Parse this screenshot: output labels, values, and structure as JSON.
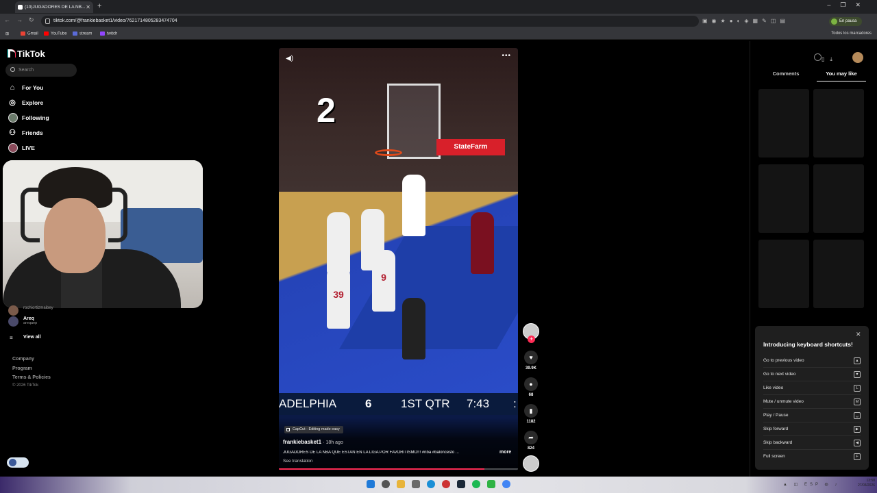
{
  "browser": {
    "tab_title": "(10)JUGADORES DE LA NB...",
    "url": "tiktok.com/@frankiebasket1/video/7621714805283474704",
    "profile_label": "En pausa",
    "bookmarks": [
      {
        "label": "Gmail",
        "color": "#ea4335"
      },
      {
        "label": "YouTube",
        "color": "#ff0000"
      },
      {
        "label": "stream",
        "color": "#5b6bd8"
      },
      {
        "label": "twitch",
        "color": "#9146ff"
      }
    ],
    "all_bookmarks": "Todos los marcadores"
  },
  "sidebar": {
    "brand": "TikTok",
    "search_placeholder": "Search",
    "nav": [
      {
        "label": "For You",
        "icon": "home-icon"
      },
      {
        "label": "Explore",
        "icon": "compass-icon"
      },
      {
        "label": "Following",
        "icon": "avatar-icon"
      },
      {
        "label": "Friends",
        "icon": "friends-icon"
      },
      {
        "label": "LIVE",
        "icon": "live-avatar-icon"
      }
    ],
    "following": [
      {
        "name": "rochiortizmaibey",
        "handle": ""
      },
      {
        "name": "Areq",
        "handle": "areqaep"
      }
    ],
    "view_all": "View all",
    "footer": [
      "Company",
      "Program",
      "Terms & Policies"
    ],
    "copyright": "© 2026 TikTok"
  },
  "video": {
    "overlay_number": "2",
    "sponsor": "StateFarm",
    "scoreboard": {
      "team": "ADELPHIA",
      "score": "6",
      "quarter": "1ST QTR",
      "clock": "7:43"
    },
    "jerseys": [
      "39",
      "9"
    ],
    "capcut": "CapCut - Editing made easy",
    "author": "frankiebasket1",
    "posted": "· 18h ago",
    "caption": "JUGADORES DE LA NBA QUE ESTAN EN LA LIGA POR FAVORITISMO!!! #nba #baloncesto ...",
    "more": "more",
    "see_translation": "See translation",
    "progress": 0.86
  },
  "actions": {
    "likes": "39.9K",
    "comments": "68",
    "saves": "1182",
    "shares": "824"
  },
  "right_panel": {
    "tab_comments": "Comments",
    "tab_you_may_like": "You may like"
  },
  "shortcuts": {
    "title": "Introducing keyboard shortcuts!",
    "items": [
      {
        "label": "Go to previous video",
        "key": "▲"
      },
      {
        "label": "Go to next video",
        "key": "▼"
      },
      {
        "label": "Like video",
        "key": "L"
      },
      {
        "label": "Mute / unmute video",
        "key": "M"
      },
      {
        "label": "Play / Pause",
        "key": "␣"
      },
      {
        "label": "Skip forward",
        "key": "▶"
      },
      {
        "label": "Skip backward",
        "key": "◀"
      },
      {
        "label": "Full screen",
        "key": "F"
      }
    ]
  },
  "taskbar": {
    "clock_time": "13:58",
    "clock_date": "27/03/2026",
    "lang": "ESP"
  }
}
